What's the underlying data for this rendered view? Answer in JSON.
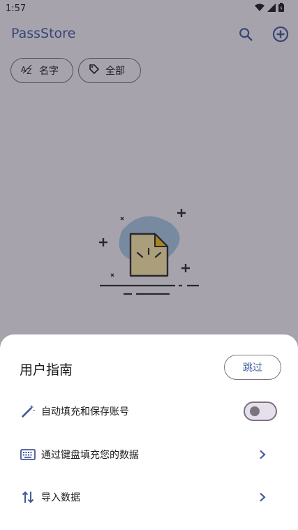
{
  "status": {
    "time": "1:57"
  },
  "app": {
    "title": "PassStore",
    "chips": [
      {
        "label": "名字",
        "icon": "sort-az-icon"
      },
      {
        "label": "全部",
        "icon": "tag-icon"
      }
    ],
    "colors": {
      "accent": "#415a9c",
      "brand": "#415a9c"
    }
  },
  "sheet": {
    "title": "用户指南",
    "skip_label": "跳过",
    "items": [
      {
        "label": "自动填充和保存账号",
        "icon": "magic-wand-icon",
        "control": "toggle",
        "toggle_on": false
      },
      {
        "label": "通过键盘填充您的数据",
        "icon": "keyboard-icon",
        "control": "chevron"
      },
      {
        "label": "导入数据",
        "icon": "import-arrows-icon",
        "control": "chevron"
      }
    ]
  }
}
